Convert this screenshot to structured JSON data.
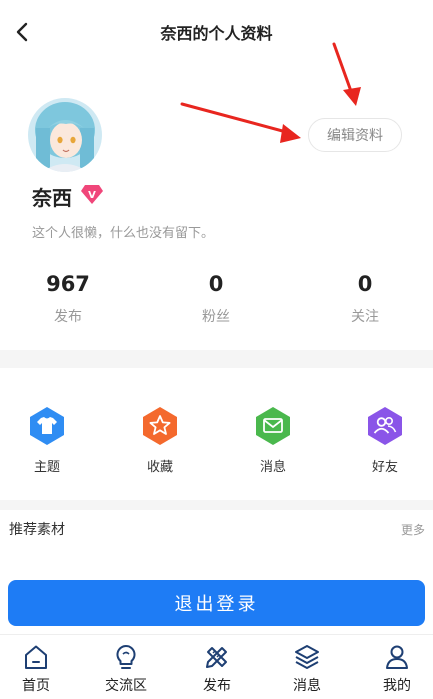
{
  "header": {
    "title": "奈西的个人资料",
    "back_icon": "chevron-left-icon"
  },
  "profile": {
    "name": "奈西",
    "badge": "V",
    "bio": "这个人很懒，什么也没有留下。",
    "edit_label": "编辑资料"
  },
  "stats": [
    {
      "value": "967",
      "label": "发布"
    },
    {
      "value": "0",
      "label": "粉丝"
    },
    {
      "value": "0",
      "label": "关注"
    }
  ],
  "quick_actions": [
    {
      "label": "主题",
      "icon": "shirt-icon",
      "color": "#2f8df3"
    },
    {
      "label": "收藏",
      "icon": "star-icon",
      "color": "#f4692d"
    },
    {
      "label": "消息",
      "icon": "mail-icon",
      "color": "#4ab84d"
    },
    {
      "label": "好友",
      "icon": "friends-icon",
      "color": "#8a55e8"
    }
  ],
  "recommend": {
    "title": "推荐素材",
    "more": "更多"
  },
  "logout_label": "退出登录",
  "tabbar": [
    {
      "label": "首页",
      "icon": "home-icon"
    },
    {
      "label": "交流区",
      "icon": "lightbulb-icon"
    },
    {
      "label": "发布",
      "icon": "pencil-ruler-icon"
    },
    {
      "label": "消息",
      "icon": "layers-icon"
    },
    {
      "label": "我的",
      "icon": "user-icon"
    }
  ],
  "colors": {
    "accent": "#1e7cf5",
    "arrow": "#e8261f",
    "badge": "#f0467a"
  }
}
